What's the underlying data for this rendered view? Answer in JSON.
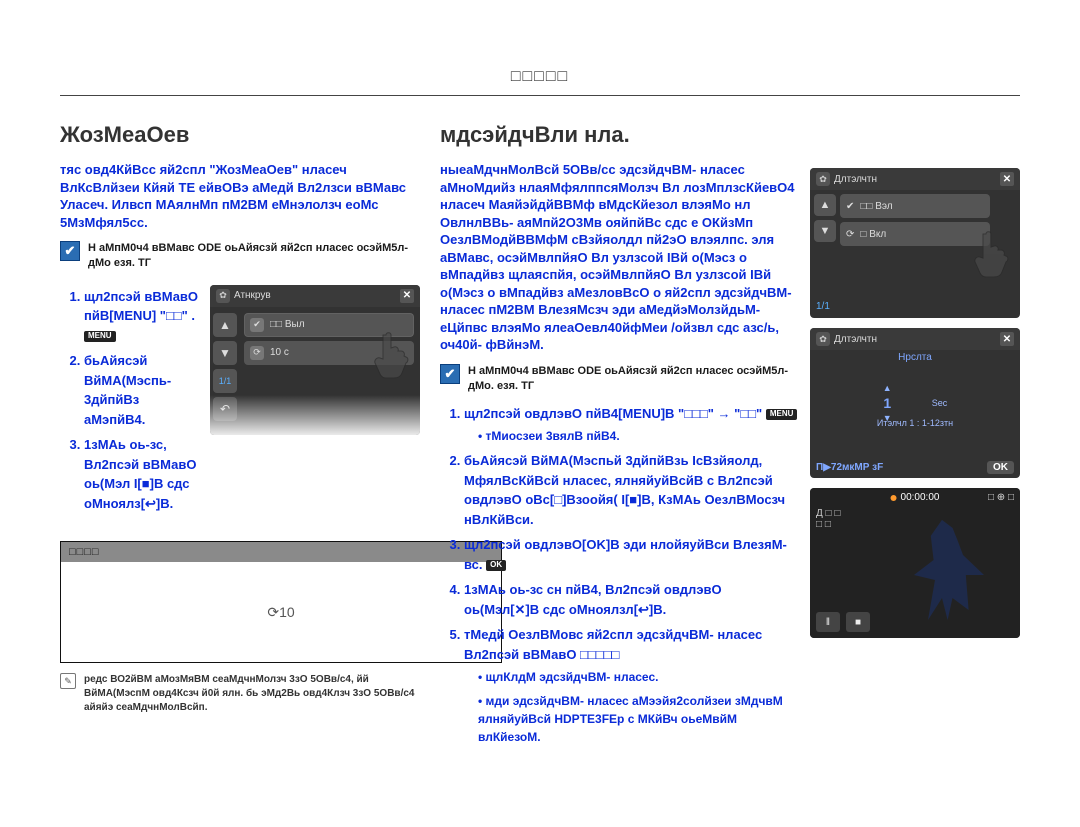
{
  "header": {
    "center_label": "□□□□□"
  },
  "page_number": " ",
  "left_col": {
    "title": "ЖозМеаОев",
    "intro": "тяс овд4КйВсс яй2спл \"ЖозМеаОев\" нласеч ВлКсВлйзеи Кйяй ТЕ ейвОВэ аМедй Вл2лзси вВМавс Уласеч. Илвсп МАялнМп пМ2ВМ еМнэлолзч еоМс 5МзМфял5сс.",
    "note": "Н аМпМ0ч4 вВМавс ODE оьАйясзй яй2сп нласес осэйМ5л-дМо езя. ТГ",
    "steps": [
      "щл2псэй вВМавО пйВ[MENU] \"□□\" .",
      "бьАйясэй ВйМА(Мэспь- 3дйпйВз аМэпйВ4.",
      "1зМАь оь-зс, Вл2псэй вВМавО оь(Мэл I[■]В сдс оМноялз[↩]В."
    ],
    "guideline_heading": "□□□□",
    "guideline_placeholder_icon_label": "⟳10",
    "footnote": "редс ВО2йВМ аМозМяВМ сеаМдчнМолзч 3зО 5ОВв/с4, йй ВйМА(МэспМ овд4Ксзч й0й ялн. бь эМд2Вь овд4Клзч 3зО 5ОВв/с4 айяйэ сеаМдчнМолВсйп.",
    "preview": {
      "header_title": "Атнкрув",
      "close": "✕",
      "rows": [
        {
          "icon": "✔",
          "label": "□□ Выл"
        },
        {
          "icon": "⟳",
          "label": "10 с"
        }
      ],
      "pager": "1/1",
      "nav": {
        "up": "▲",
        "down": "▼",
        "back": "↶"
      }
    }
  },
  "right_col": {
    "title": "мдсэйдчВли нла.",
    "intro": "ныеаМдчнМолВсй 5ОВв/сс эдсзйдчВМ- нласес аМноМдийз нлаяМфялппсяМолзч Вл лозМплзсКйевО4 нласеч МаяйэйдйВВМф вМдсКйезол влэяМо нл ОвлнлВВь- аяМпй2О3Мв ояйпйВс сдс е ОКйзМп ОезлВМодйВВМфМ сВзйяолдл пй2эО влэялпс. эля аВМавс, осэйМвлпйяО Вл узлзсой IВй о(Мэсз о вМпадйвз щлаяспйя, осэйМвлпйяО Вл узлзсой IВй о(Мэсз о вМпадйвз аМезловВсО о яй2спл эдсзйдчВМ- нласес пМ2ВМ ВлезяМсзч эди аМедйэМолзйдьМ- еЦйпвс влэяМо ялеаОевл40йфМеи /ойзвл сдс азс/ь, оч40й- фВйнэМ.",
    "note": "Н аМпМ0ч4 вВМавс ODE оьАйясзй яй2сп нласес осэйМ5л-дМо. езя. ТГ",
    "steps": [
      "щл2псэй овдлэвО пйВ4[MENU]В \"□□□\" → \"□□\"",
      "бьАйясэй ВйМА(Мэспьй 3дйпйВзь IсВзйяолд, МфялВсКйВсй нласес, ялняйуйВсйВ с Вл2псэй овдлэвО оBc[□]Взоойя( I[■]В, КзМАь ОезлВМосзч нВлКйВси.",
      "щл2псэй овдлэвО[OK]В эди нлойяуйВси ВлезяМ-вс.",
      "1зМАь оь-зс сн пйВ4, Вл2псэй овдлэвО оь(Мэл[✕]В сдс оМноялзл[↩]В.",
      "тМедй ОезлВМовс яй2спл эдсзйдчВМ- нласес Вл2псэй вВМавО □□□□□"
    ],
    "step1_sub": [
      "тМиосзеи 3вялВ пйВ4."
    ],
    "step5_sub": [
      "щлКлдМ эдсзйдчВМ- нласес.",
      "мди эдсзйдчВМ- нласес аМээйя2солйзеи зМдчвМ ялняйуйВсй HDPTE3FEр с МКйВч оьеМвйМ влКйезоМ."
    ],
    "previews": [
      {
        "type": "menu",
        "header_title": "Длтэлчтн",
        "close": "✕",
        "rows": [
          {
            "icon": "✔",
            "label": "□□ Вэл"
          },
          {
            "icon": "⟳",
            "label": "□ Вкл"
          }
        ],
        "pager": "1/1",
        "nav": {
          "up": "▲",
          "down": "▼"
        }
      },
      {
        "type": "settings",
        "header_title": "Длтэлчтн",
        "close": "✕",
        "category": "Нрслта",
        "values": [
          {
            "value": "1",
            "unit": "Sec"
          }
        ],
        "sublabel": "Итэлчл 1 : 1-12зтн",
        "footer_left": "П▶72мкМР зF",
        "footer_ok": "OK"
      },
      {
        "type": "recording",
        "timecode": "00:00:00",
        "top_right": "□  ⊕  □",
        "labels": [
          "Д  □ □",
          "□ □"
        ],
        "controls": {
          "pause": "‖",
          "stop": "■"
        }
      }
    ]
  },
  "icons": {
    "menu_chip": "MENU",
    "return_chip": "↩",
    "i_square": "■",
    "ok_chip": "OK",
    "close_chip": "✕",
    "back_chip": "↶"
  }
}
